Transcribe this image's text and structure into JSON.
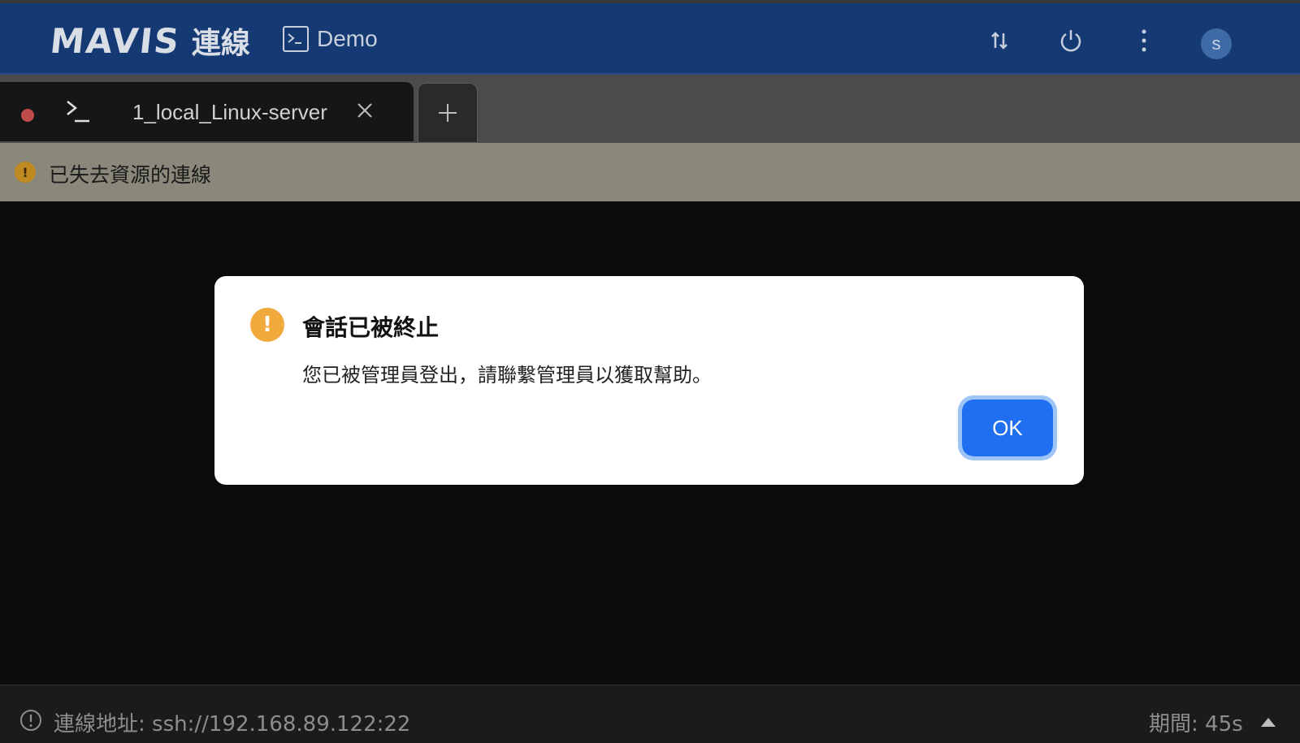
{
  "header": {
    "logo_word": "MAVIS",
    "logo_subtitle": "連線",
    "session_name": "Demo",
    "avatar_initial": "s",
    "icons": [
      "transfer-icon",
      "power-icon",
      "more-vertical-icon"
    ]
  },
  "tabs": [
    {
      "label": "1_local_Linux-server",
      "status": "disconnected",
      "status_color": "#bf4b4b"
    }
  ],
  "warning_bar": {
    "text": "已失去資源的連線",
    "icon_color": "#c08a22"
  },
  "modal": {
    "title": "會話已被終止",
    "message": "您已被管理員登出，請聯繫管理員以獲取幫助。",
    "ok_label": "OK",
    "icon_color": "#f0a93a",
    "button_color": "#1f6ff0"
  },
  "status_bar": {
    "address": "連線地址: ssh://192.168.89.122:22",
    "duration": "期間: 45s"
  },
  "colors": {
    "header_bg": "#153a73",
    "tabbar_bg": "#4b4b4b",
    "warning_bg": "#8a887b",
    "terminal_bg": "#0b0b0b"
  }
}
